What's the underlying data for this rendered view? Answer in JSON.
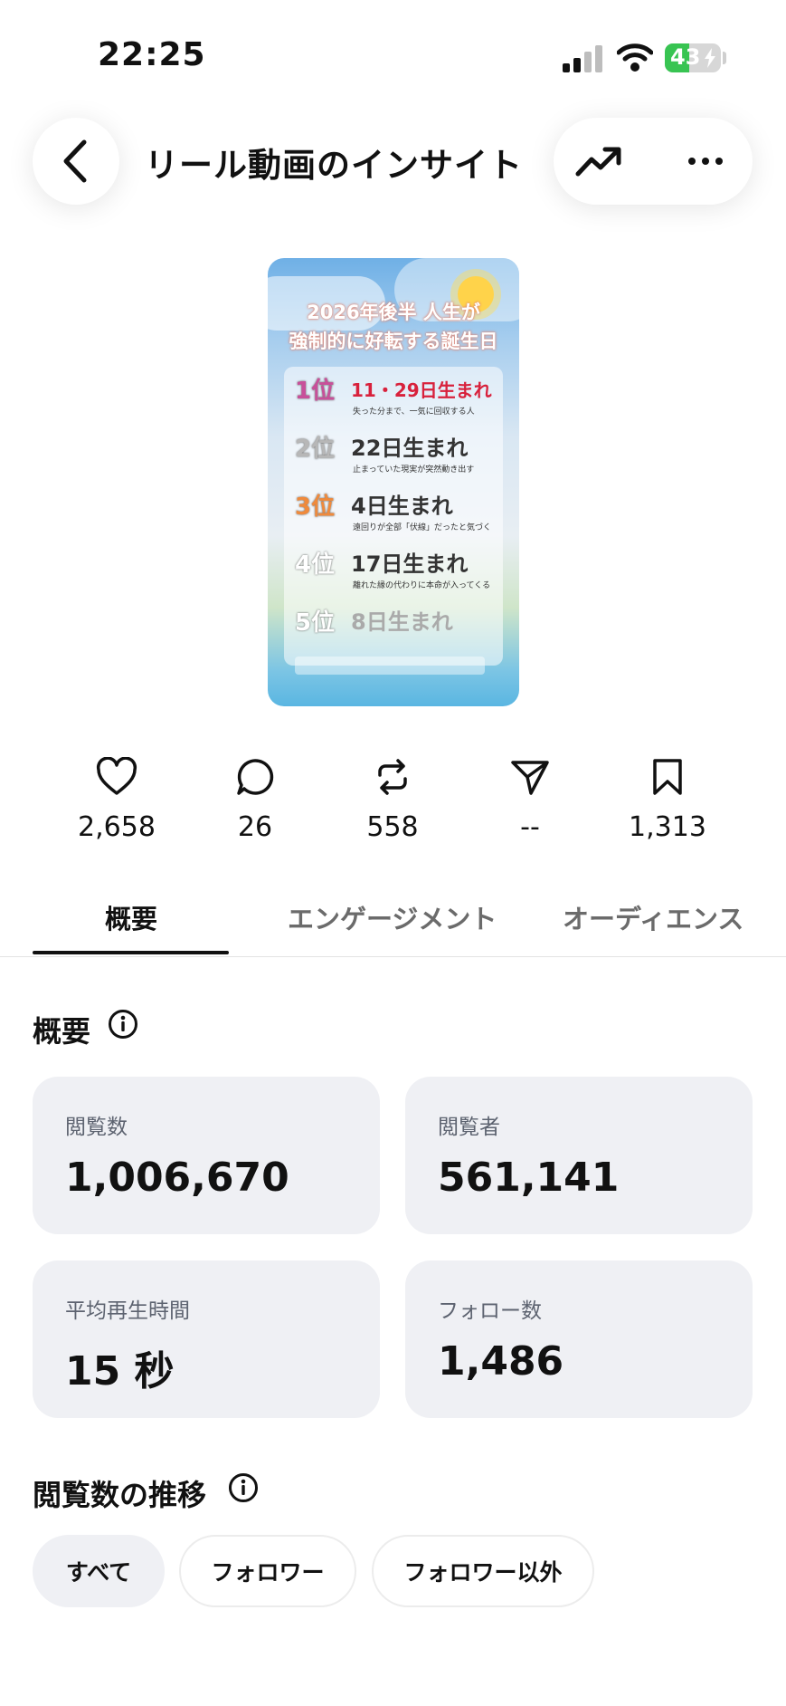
{
  "status_bar": {
    "time": "22:25",
    "battery_level": 43,
    "battery_text": "43"
  },
  "header": {
    "title": "リール動画のインサイト"
  },
  "thumbnail": {
    "title_line1": "2026年後半 人生が",
    "title_line2": "強制的に好転する誕生日",
    "ranks": [
      {
        "rank": "1位",
        "label": "11・29日生まれ",
        "sub": "失った分まで、一気に回収する人",
        "rank_color": "#c8509a",
        "label_color": "#d8213c"
      },
      {
        "rank": "2位",
        "label": "22日生まれ",
        "sub": "止まっていた現実が突然動き出す",
        "rank_color": "#b7b7b7",
        "label_color": "#333333"
      },
      {
        "rank": "3位",
        "label": "4日生まれ",
        "sub": "遠回りが全部「伏線」だったと気づく",
        "rank_color": "#ef8a3c",
        "label_color": "#333333"
      },
      {
        "rank": "4位",
        "label": "17日生まれ",
        "sub": "離れた縁の代わりに本命が入ってくる",
        "rank_color": "#ffffff",
        "label_color": "#333333"
      },
      {
        "rank": "5位",
        "label": "8日生まれ",
        "sub": "",
        "rank_color": "#ffffff",
        "label_color": "#aaaaaa"
      }
    ]
  },
  "stats": [
    {
      "icon": "heart-icon",
      "value": "2,658"
    },
    {
      "icon": "comment-icon",
      "value": "26"
    },
    {
      "icon": "repost-icon",
      "value": "558"
    },
    {
      "icon": "share-icon",
      "value": "--"
    },
    {
      "icon": "bookmark-icon",
      "value": "1,313"
    }
  ],
  "tabs": [
    {
      "label": "概要",
      "active": true
    },
    {
      "label": "エンゲージメント",
      "active": false
    },
    {
      "label": "オーディエンス",
      "active": false
    }
  ],
  "overview": {
    "title": "概要",
    "cards": [
      {
        "label": "閲覧数",
        "value": "1,006,670"
      },
      {
        "label": "閲覧者",
        "value": "561,141"
      },
      {
        "label": "平均再生時間",
        "value": "15 秒"
      },
      {
        "label": "フォロー数",
        "value": "1,486"
      }
    ]
  },
  "trend": {
    "title": "閲覧数の推移",
    "filters": [
      {
        "label": "すべて",
        "active": true
      },
      {
        "label": "フォロワー",
        "active": false
      },
      {
        "label": "フォロワー以外",
        "active": false
      }
    ]
  }
}
